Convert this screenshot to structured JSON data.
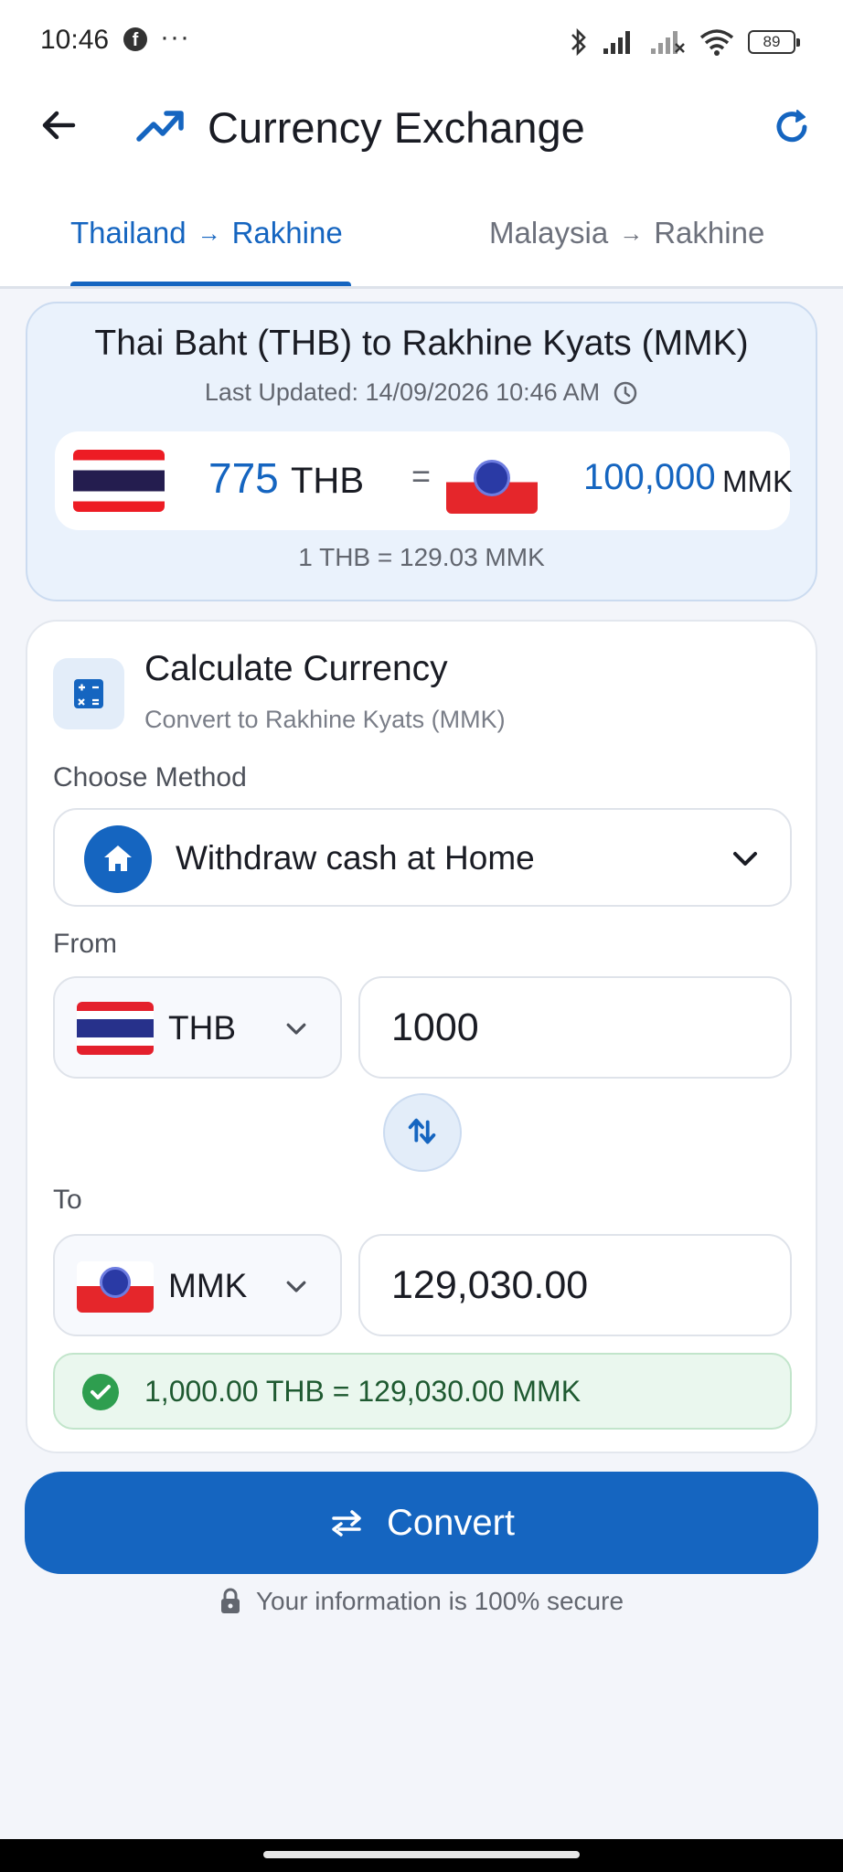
{
  "status_bar": {
    "time": "10:46",
    "fb_glyph": "f",
    "dots": "···",
    "battery": "89",
    "icons": [
      "facebook-icon",
      "bluetooth-icon",
      "signal-icon",
      "signal-off-icon",
      "wifi-icon",
      "battery-icon"
    ]
  },
  "app_bar": {
    "title": "Currency Exchange",
    "icons": [
      "back-arrow-icon",
      "trending-up-icon",
      "refresh-icon"
    ],
    "accent": "#1565c0"
  },
  "tabs": [
    {
      "from": "Thailand",
      "arrow": "→",
      "to": "Rakhine",
      "active": true
    },
    {
      "from": "Malaysia",
      "arrow": "→",
      "to": "Rakhine",
      "active": false
    }
  ],
  "rate_card": {
    "title": "Thai Baht (THB) to Rakhine Kyats (MMK)",
    "last_updated": "Last Updated: 14/09/2026 10:46 AM",
    "from_amount": "775",
    "from_currency": "THB",
    "equals": "=",
    "to_amount": "100,000",
    "to_currency": "MMK",
    "unit_rate": "1 THB = 129.03 MMK"
  },
  "calculator": {
    "title": "Calculate Currency",
    "subtitle": "Convert to Rakhine Kyats (MMK)",
    "method_label": "Choose Method",
    "method_value": "Withdraw cash at Home",
    "from_label": "From",
    "from_currency": "THB",
    "from_amount": "1000",
    "to_label": "To",
    "to_currency": "MMK",
    "to_amount": "129,030.00",
    "result": "1,000.00 THB = 129,030.00 MMK",
    "success_color": "#2e9e4f"
  },
  "convert_button": {
    "label": "Convert"
  },
  "footer": {
    "secure_text": "Your information is 100% secure"
  }
}
